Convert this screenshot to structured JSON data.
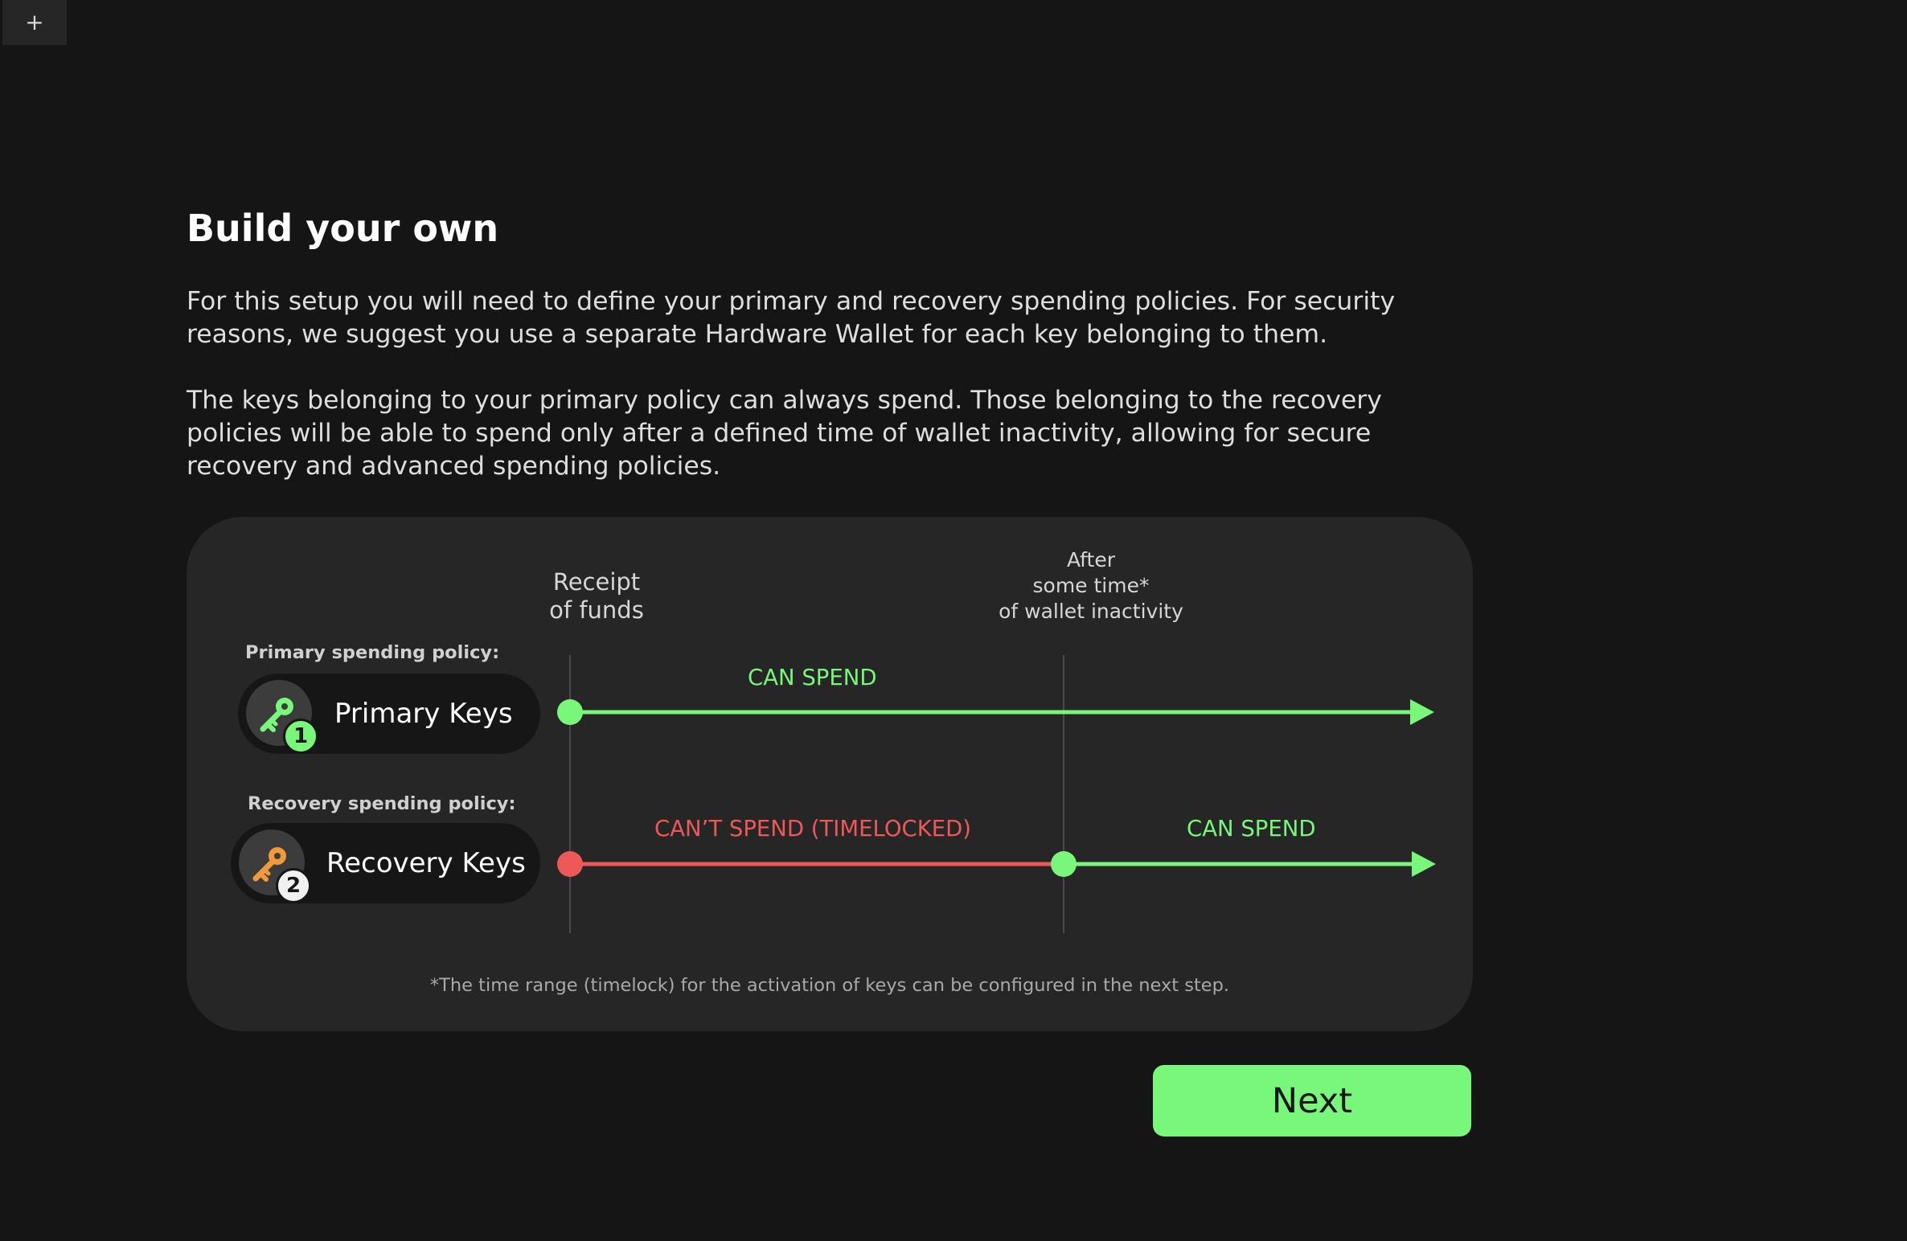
{
  "tab_bar": {
    "add_tab_symbol": "+"
  },
  "page": {
    "title": "Build your own",
    "paragraph_1": "For this setup you will need to define your primary and recovery spending policies. For security reasons, we suggest you use a separate Hardware Wallet for each key belonging to them.",
    "paragraph_2": "The keys belonging to your primary policy can always spend. Those belonging to the recovery policies will be able to spend only after a defined time of wallet inactivity, allowing for secure recovery and advanced spending policies."
  },
  "diagram": {
    "receipt_label": "Receipt\nof funds",
    "after_label": "After\nsome time*\nof wallet inactivity",
    "primary": {
      "policy_label": "Primary spending policy:",
      "key_name": "Primary Keys",
      "badge": "1",
      "icon": "key-icon",
      "status": "CAN SPEND"
    },
    "recovery": {
      "policy_label": "Recovery spending policy:",
      "key_name": "Recovery Keys",
      "badge": "2",
      "icon": "key-icon",
      "status_locked": "CAN’T SPEND (TIMELOCKED)",
      "status_unlocked": "CAN SPEND"
    },
    "footnote": "*The time range (timelock) for the activation of keys can be configured in the next step."
  },
  "actions": {
    "next_label": "Next"
  },
  "colors": {
    "background": "#151515",
    "card": "#262626",
    "accent_green": "#79f77a",
    "timelock_red": "#ee5858",
    "primary_key": "#79f77a",
    "recovery_key": "#f29a3a"
  }
}
